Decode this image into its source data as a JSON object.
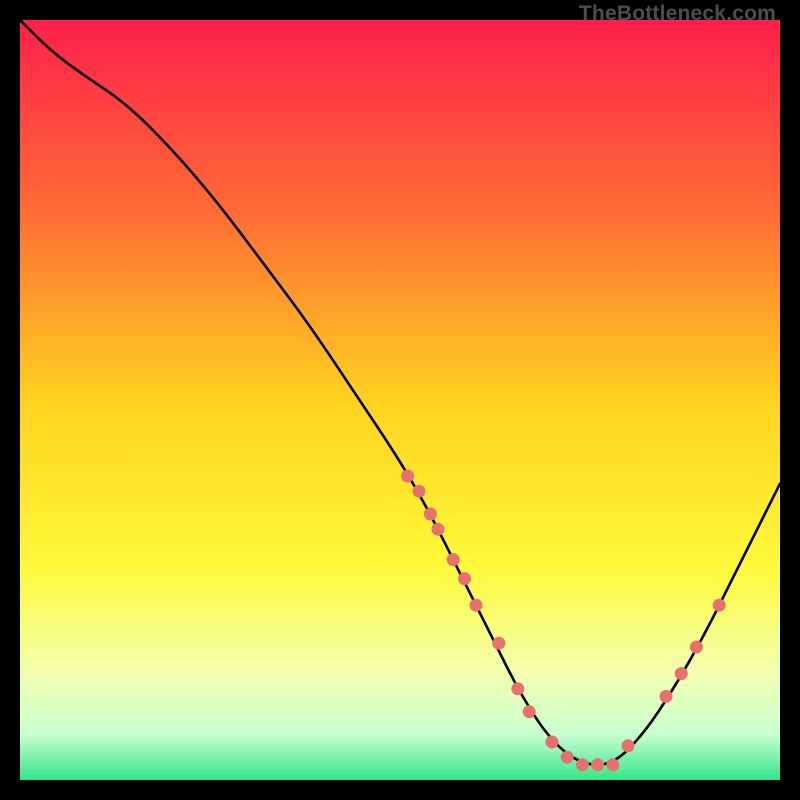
{
  "watermark": "TheBottleneck.com",
  "chart_data": {
    "type": "line",
    "title": "",
    "xlabel": "",
    "ylabel": "",
    "xlim": [
      0,
      100
    ],
    "ylim": [
      0,
      100
    ],
    "grid": false,
    "legend": {
      "visible": false
    },
    "background_gradient": {
      "stops": [
        {
          "offset": 0.0,
          "color": "#ff1f4b"
        },
        {
          "offset": 0.25,
          "color": "#ff6b35"
        },
        {
          "offset": 0.5,
          "color": "#ffd21f"
        },
        {
          "offset": 0.72,
          "color": "#fff93a"
        },
        {
          "offset": 0.86,
          "color": "#f2ffb0"
        },
        {
          "offset": 0.94,
          "color": "#c8ffd0"
        },
        {
          "offset": 1.0,
          "color": "#33e58a"
        }
      ]
    },
    "series": [
      {
        "name": "bottleneck-curve",
        "color": "#000000",
        "x": [
          0,
          4,
          8,
          14,
          20,
          26,
          32,
          38,
          44,
          50,
          54,
          58,
          62,
          66,
          70,
          74,
          78,
          82,
          86,
          90,
          94,
          98,
          100
        ],
        "y": [
          100,
          96,
          93,
          89,
          83,
          76,
          68,
          60,
          51,
          42,
          35,
          27,
          19,
          11,
          5,
          2,
          2,
          6,
          12,
          19,
          27,
          35,
          39
        ]
      }
    ],
    "markers": {
      "name": "highlight-points",
      "color": "#e9716d",
      "radius": 6.5,
      "x": [
        51,
        52.5,
        54,
        55,
        57,
        58.5,
        60,
        63,
        65.5,
        67,
        70,
        72,
        74,
        76,
        78,
        80,
        85,
        87,
        89,
        92
      ],
      "y": [
        40,
        38,
        35,
        33,
        29,
        26.5,
        23,
        18,
        12,
        9,
        5,
        3,
        2,
        2,
        2,
        4.5,
        11,
        14,
        17.5,
        23
      ]
    }
  }
}
